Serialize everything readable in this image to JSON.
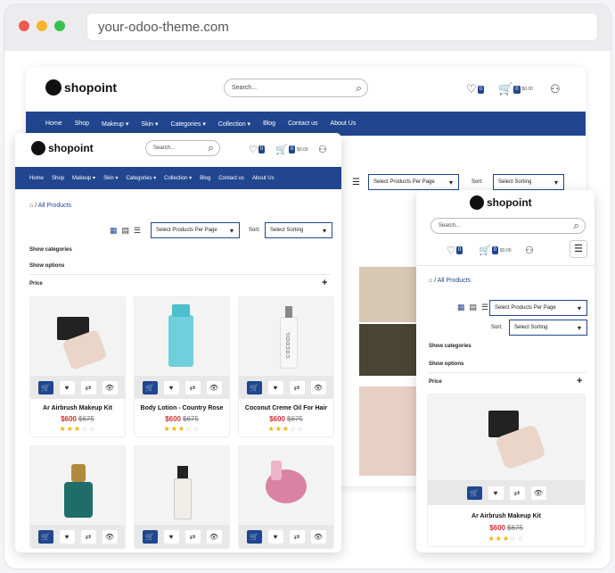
{
  "browser": {
    "url": "your-odoo-theme.com",
    "dot_colors": [
      "#f05a4f",
      "#f6b530",
      "#35c24a"
    ]
  },
  "brand": {
    "name": "shopoint"
  },
  "search": {
    "placeholder": "Search..."
  },
  "header": {
    "wishlist_count": "0",
    "cart_count": "0",
    "cart_total": "$0.00"
  },
  "nav": [
    {
      "label": "Home",
      "dropdown": false
    },
    {
      "label": "Shop",
      "dropdown": false
    },
    {
      "label": "Makeup",
      "dropdown": true
    },
    {
      "label": "Skin",
      "dropdown": true
    },
    {
      "label": "Categories",
      "dropdown": true
    },
    {
      "label": "Collection",
      "dropdown": true
    },
    {
      "label": "Blog",
      "dropdown": false
    },
    {
      "label": "Contact us",
      "dropdown": false
    },
    {
      "label": "About Us",
      "dropdown": false
    }
  ],
  "toolbar": {
    "per_page": "Select Products Per Page",
    "sort_label": "Sort:",
    "sort_value": "Select Sorting"
  },
  "breadcrumb": {
    "current": "All Products",
    "separator": "/"
  },
  "filters": {
    "categories": "Show categories",
    "options": "Show options",
    "price": "Price",
    "plus": "+"
  },
  "products": [
    {
      "name": "Ar Airbrush Makeup Kit",
      "price": "$600",
      "old_price": "$675",
      "rating": 3
    },
    {
      "name": "Body Lotion - Country Rose",
      "price": "$600",
      "old_price": "$675",
      "rating": 3
    },
    {
      "name": "Coconut Creme Oil For Hair",
      "price": "$600",
      "old_price": "$675",
      "rating": 3
    },
    {
      "name": "",
      "price": "",
      "old_price": "",
      "rating": 0
    },
    {
      "name": "",
      "price": "",
      "old_price": "",
      "rating": 0
    },
    {
      "name": "",
      "price": "",
      "old_price": "",
      "rating": 0
    }
  ],
  "product_label": {
    "coconut": "COCOOIL"
  },
  "colors": {
    "accent": "#21468f",
    "sale": "#d32f2f",
    "star": "#f1b000"
  }
}
